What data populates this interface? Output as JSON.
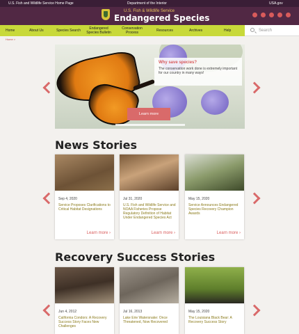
{
  "topbar": {
    "left": "U.S. Fish and Wildlife Service Home Page",
    "center": "Department of the Interior",
    "right": "USA.gov"
  },
  "header": {
    "subtitle": "U.S. Fish & Wildlife Service",
    "title": "Endangered Species",
    "social_icons": [
      "facebook-icon",
      "twitter-icon",
      "youtube-icon",
      "flickr-icon",
      "instagram-icon"
    ]
  },
  "nav": {
    "items": [
      {
        "label": "Home"
      },
      {
        "label": "About Us"
      },
      {
        "label": "Species Search"
      },
      {
        "label": "Endangered Species Bulletin"
      },
      {
        "label": "Conservation Process"
      },
      {
        "label": "Resources"
      },
      {
        "label": "Archives"
      },
      {
        "label": "Help"
      }
    ],
    "search_placeholder": "Search"
  },
  "breadcrumb": "Home >",
  "hero": {
    "question": "Why save species?",
    "text": "The conservation work done is extremely important for our country in many ways!",
    "button": "Learn more"
  },
  "news": {
    "title": "News Stories",
    "cards": [
      {
        "date": "Sep 4, 2020",
        "title": "Service Proposes Clarifications to Critical Habitat Designations",
        "more": "Learn more"
      },
      {
        "date": "Jul 31, 2020",
        "title": "U.S. Fish and Wildlife Service and NOAA Fisheries Propose Regulatory Definition of Habitat Under Endangered Species Act",
        "more": "Learn more"
      },
      {
        "date": "May 15, 2020",
        "title": "Service Announces Endangered Species Recovery Champion Awards",
        "more": "Learn more"
      }
    ]
  },
  "recovery": {
    "title": "Recovery Success Stories",
    "cards": [
      {
        "date": "Jun 4, 2012",
        "title": "California Condors: A Recovery Success Story Faces New Challenges"
      },
      {
        "date": "Jul 16, 2013",
        "title": "Lake Erie Watersnake: Once Threatened, Now Recovered"
      },
      {
        "date": "May 15, 2020",
        "title": "The Louisiana Black Bear: A Recovery Success Story"
      }
    ]
  },
  "colors": {
    "top_bar": "#3a1e36",
    "header": "#512844",
    "nav": "#c8d93a",
    "accent": "#d85b5b",
    "card_title": "#8a7a1a"
  }
}
